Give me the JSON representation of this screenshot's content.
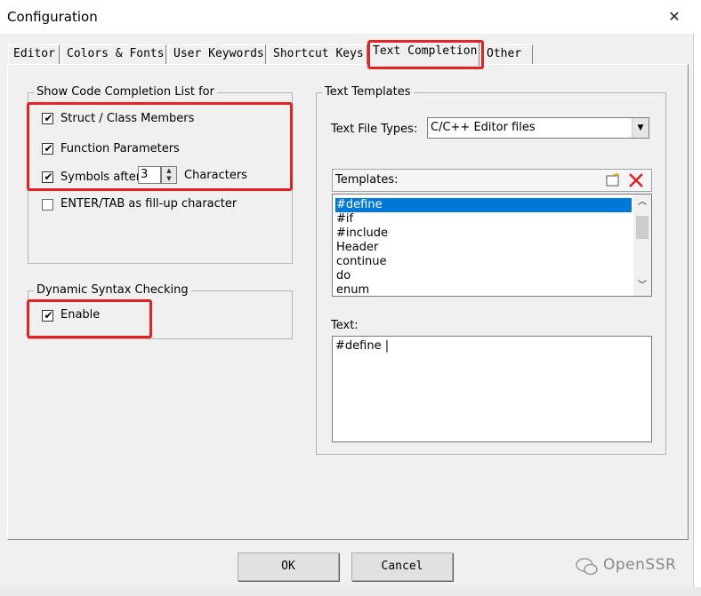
{
  "window": {
    "title": "Configuration",
    "close_symbol": "✕"
  },
  "tabs": [
    {
      "label": "Editor",
      "active": false
    },
    {
      "label": "Colors & Fonts",
      "active": false
    },
    {
      "label": "User Keywords",
      "active": false
    },
    {
      "label": "Shortcut Keys",
      "active": false
    },
    {
      "label": "Text Completion",
      "active": true
    },
    {
      "label": "Other",
      "active": false
    }
  ],
  "code_completion": {
    "group_label": "Show Code Completion List for",
    "options": [
      {
        "label": "Struct / Class Members",
        "checked": true
      },
      {
        "label": "Function Parameters",
        "checked": true
      },
      {
        "label": "Symbols after",
        "checked": true
      },
      {
        "label": "ENTER/TAB as fill-up character",
        "checked": false
      }
    ],
    "symbols_after_value": "3",
    "characters_label": "Characters"
  },
  "syntax_checking": {
    "group_label": "Dynamic Syntax Checking",
    "enable_label": "Enable",
    "enabled": true
  },
  "text_templates": {
    "group_label": "Text Templates",
    "file_types_label": "Text File Types:",
    "file_types_value": "C/C++ Editor files",
    "templates_label": "Templates:",
    "templates": [
      "#define",
      "#if",
      "#include",
      "Header",
      "continue",
      "do",
      "enum"
    ],
    "selected_index": 0,
    "text_label": "Text:",
    "text_value": "#define |"
  },
  "buttons": {
    "ok": "OK",
    "cancel": "Cancel"
  },
  "highlight_color": "#e52222",
  "watermark": {
    "text": "OpenSSR",
    "icon": "wechat-icon"
  }
}
